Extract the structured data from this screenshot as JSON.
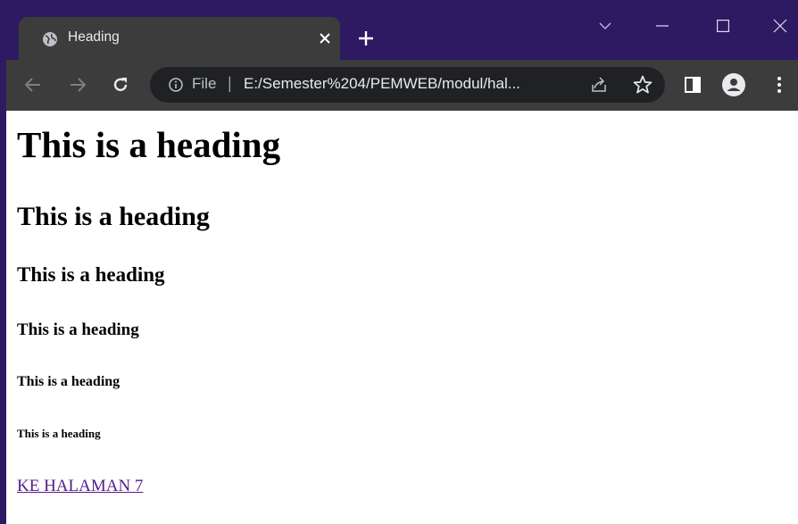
{
  "tab": {
    "title": "Heading",
    "favicon": "globe-icon"
  },
  "address_bar": {
    "scheme_label": "File",
    "separator": "|",
    "url": "E:/Semester%204/PEMWEB/modul/hal..."
  },
  "colors": {
    "frame": "#2d1a63",
    "toolbar": "#3c3c3c",
    "omnibox": "#202124",
    "link_visited": "#551a8b"
  },
  "page": {
    "headings": [
      {
        "level": 1,
        "text": "This is a heading"
      },
      {
        "level": 2,
        "text": "This is a heading"
      },
      {
        "level": 3,
        "text": "This is a heading"
      },
      {
        "level": 4,
        "text": "This is a heading"
      },
      {
        "level": 5,
        "text": "This is a heading"
      },
      {
        "level": 6,
        "text": "This is a heading"
      }
    ],
    "link": {
      "text": "KE HALAMAN 7"
    }
  }
}
